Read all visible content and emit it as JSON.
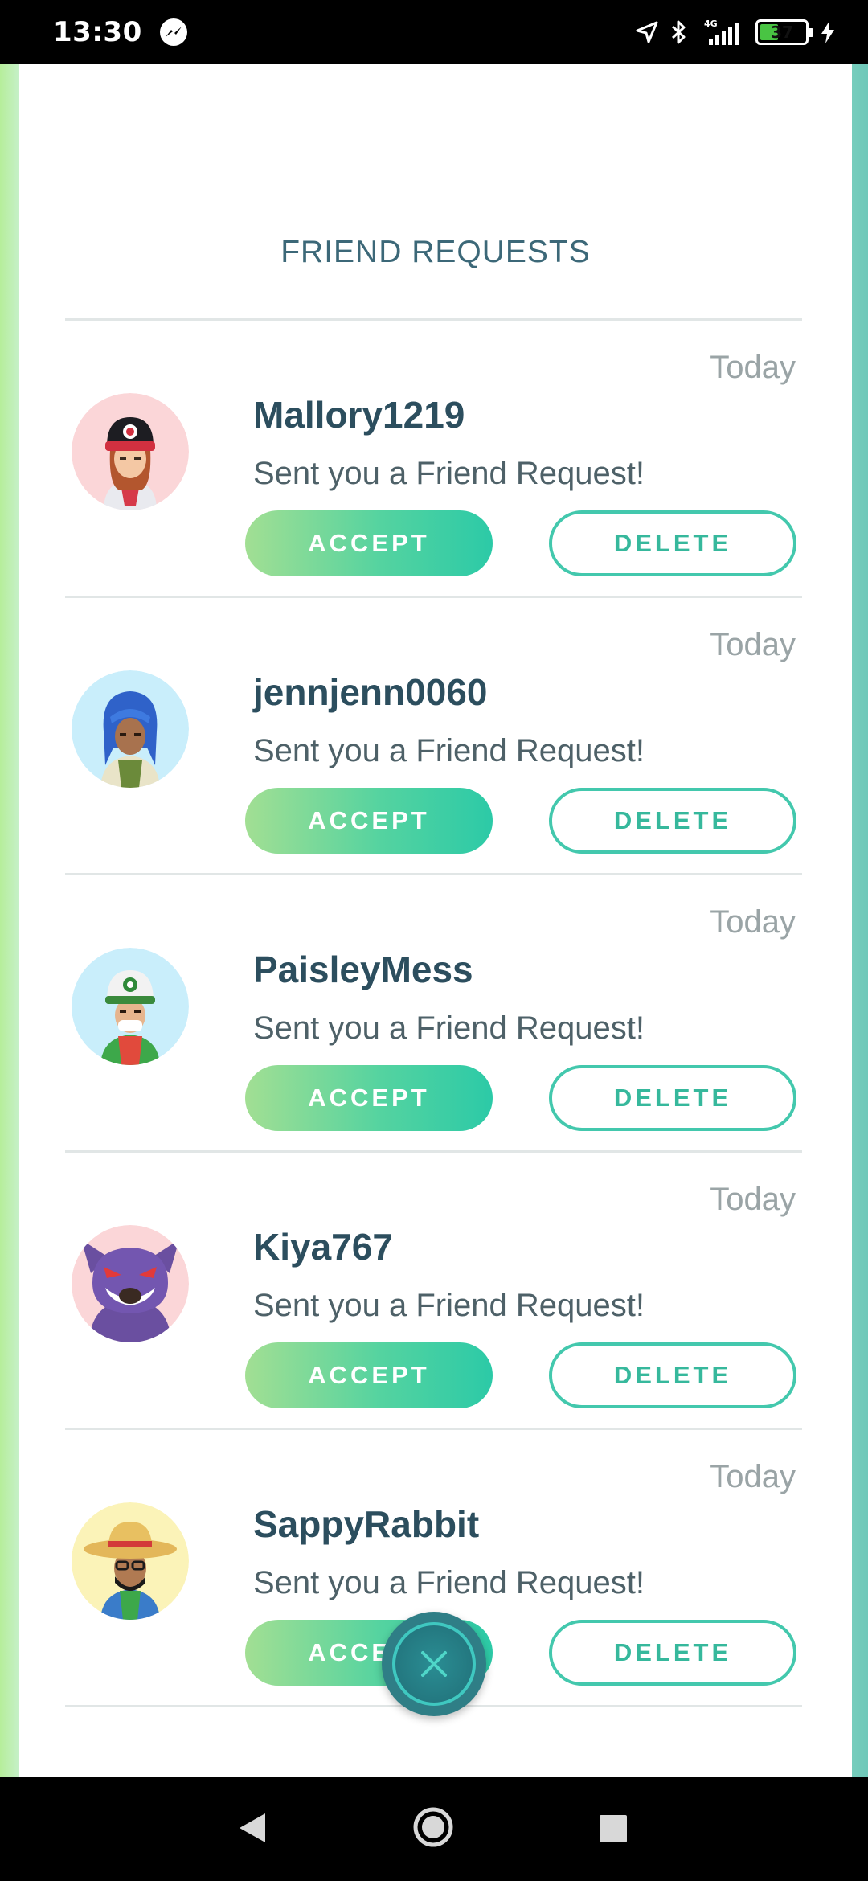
{
  "status_bar": {
    "time": "13:30",
    "network": "4G",
    "battery": "37"
  },
  "panel": {
    "title": "FRIEND REQUESTS"
  },
  "requests": [
    {
      "name": "Mallory1219",
      "date": "Today",
      "message": "Sent you a Friend Request!",
      "accept_label": "ACCEPT",
      "delete_label": "DELETE"
    },
    {
      "name": "jennjenn0060",
      "date": "Today",
      "message": "Sent you a Friend Request!",
      "accept_label": "ACCEPT",
      "delete_label": "DELETE"
    },
    {
      "name": "PaisleyMess",
      "date": "Today",
      "message": "Sent you a Friend Request!",
      "accept_label": "ACCEPT",
      "delete_label": "DELETE"
    },
    {
      "name": "Kiya767",
      "date": "Today",
      "message": "Sent you a Friend Request!",
      "accept_label": "ACCEPT",
      "delete_label": "DELETE"
    },
    {
      "name": "SappyRabbit",
      "date": "Today",
      "message": "Sent you a Friend Request!",
      "accept_label": "ACCEPT",
      "delete_label": "DELETE"
    }
  ],
  "colors": {
    "accent": "#43c8ad",
    "title": "#3c6878",
    "name": "#2c4e5e",
    "close_button": "#2f7e86"
  },
  "icons": {
    "close": "close-icon",
    "messenger": "messenger-icon",
    "location": "location-arrow-icon",
    "bluetooth": "bluetooth-icon",
    "signal": "signal-icon",
    "battery": "battery-icon",
    "charging": "charging-bolt-icon",
    "nav_back": "back-triangle-icon",
    "nav_home": "home-circle-icon",
    "nav_recent": "recents-square-icon"
  }
}
